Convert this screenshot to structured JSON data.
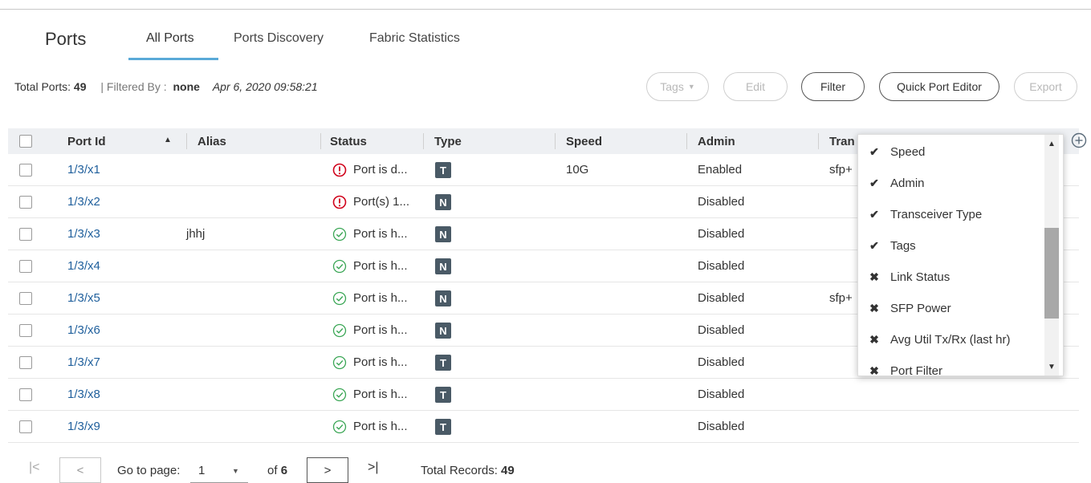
{
  "header": {
    "title": "Ports",
    "tabs": [
      {
        "label": "All Ports",
        "active": true
      },
      {
        "label": "Ports Discovery",
        "active": false
      },
      {
        "label": "Fabric Statistics",
        "active": false
      }
    ]
  },
  "infobar": {
    "total_label": "Total Ports:",
    "total_value": "49",
    "filtered_label": "| Filtered By :",
    "filtered_value": "none",
    "timestamp": "Apr 6, 2020 09:58:21"
  },
  "toolbar": {
    "tags_label": "Tags",
    "edit_label": "Edit",
    "filter_label": "Filter",
    "quick_port_editor_label": "Quick Port Editor",
    "export_label": "Export"
  },
  "table": {
    "columns": [
      "Port Id",
      "Alias",
      "Status",
      "Type",
      "Speed",
      "Admin",
      "Tran"
    ],
    "rows": [
      {
        "port_id": "1/3/x1",
        "alias": "",
        "status": "Port is d...",
        "status_kind": "error",
        "type": "T",
        "speed": "10G",
        "admin": "Enabled",
        "tran": "sfp+"
      },
      {
        "port_id": "1/3/x2",
        "alias": "",
        "status": "Port(s) 1...",
        "status_kind": "error",
        "type": "N",
        "speed": "",
        "admin": "Disabled",
        "tran": ""
      },
      {
        "port_id": "1/3/x3",
        "alias": "jhhj",
        "status": "Port is h...",
        "status_kind": "ok",
        "type": "N",
        "speed": "",
        "admin": "Disabled",
        "tran": ""
      },
      {
        "port_id": "1/3/x4",
        "alias": "",
        "status": "Port is h...",
        "status_kind": "ok",
        "type": "N",
        "speed": "",
        "admin": "Disabled",
        "tran": ""
      },
      {
        "port_id": "1/3/x5",
        "alias": "",
        "status": "Port is h...",
        "status_kind": "ok",
        "type": "N",
        "speed": "",
        "admin": "Disabled",
        "tran": "sfp+"
      },
      {
        "port_id": "1/3/x6",
        "alias": "",
        "status": "Port is h...",
        "status_kind": "ok",
        "type": "N",
        "speed": "",
        "admin": "Disabled",
        "tran": ""
      },
      {
        "port_id": "1/3/x7",
        "alias": "",
        "status": "Port is h...",
        "status_kind": "ok",
        "type": "T",
        "speed": "",
        "admin": "Disabled",
        "tran": ""
      },
      {
        "port_id": "1/3/x8",
        "alias": "",
        "status": "Port is h...",
        "status_kind": "ok",
        "type": "T",
        "speed": "",
        "admin": "Disabled",
        "tran": ""
      },
      {
        "port_id": "1/3/x9",
        "alias": "",
        "status": "Port is h...",
        "status_kind": "ok",
        "type": "T",
        "speed": "",
        "admin": "Disabled",
        "tran": ""
      }
    ]
  },
  "column_chooser": {
    "items": [
      {
        "label": "Speed",
        "checked": true
      },
      {
        "label": "Admin",
        "checked": true
      },
      {
        "label": "Transceiver Type",
        "checked": true
      },
      {
        "label": "Tags",
        "checked": true
      },
      {
        "label": "Link Status",
        "checked": false
      },
      {
        "label": "SFP Power",
        "checked": false
      },
      {
        "label": "Avg Util Tx/Rx (last hr)",
        "checked": false
      },
      {
        "label": "Port Filter",
        "checked": false
      }
    ]
  },
  "pagination": {
    "go_to_label": "Go to page:",
    "current_page": "1",
    "of_label": "of",
    "total_pages": "6",
    "total_records_label": "Total Records:",
    "total_records": "49"
  },
  "colors": {
    "link": "#1f5f9c",
    "accent": "#5aaad8",
    "error": "#d0021b",
    "ok": "#3aa655",
    "badge": "#4a5a66"
  },
  "icons": {
    "add_column": "plus-circle-icon",
    "error": "alert-circle-icon",
    "ok": "check-circle-icon",
    "checked": "check-icon",
    "unchecked": "x-icon"
  }
}
